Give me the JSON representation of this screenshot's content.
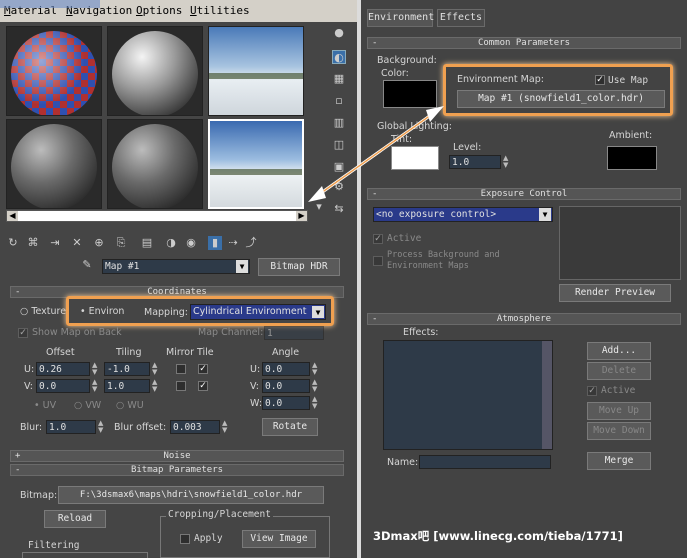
{
  "menu": {
    "items": [
      "Material",
      "Navigation",
      "Options",
      "Utilities"
    ]
  },
  "tabs": [
    "Environment",
    "Effects"
  ],
  "map_name": "Map #1",
  "map_type_button": "Bitmap HDR",
  "coordinates": {
    "title": "Coordinates",
    "texture_label": "Texture",
    "environ_label": "Environ",
    "mapping_label": "Mapping:",
    "mapping_value": "Cylindrical Environment",
    "show_map": "Show Map on Back",
    "map_channel_label": "Map Channel:",
    "map_channel_value": "1",
    "offset_label": "Offset",
    "tiling_label": "Tiling",
    "mirror_tile_label": "Mirror Tile",
    "angle_label": "Angle",
    "axes": [
      "U:",
      "V:",
      "W:"
    ],
    "offset_u": "0.26",
    "offset_v": "0.0",
    "tiling_u": "-1.0",
    "tiling_v": "1.0",
    "angle_u": "0.0",
    "angle_v": "0.0",
    "angle_w": "0.0",
    "uvw": [
      "UV",
      "VW",
      "WU"
    ],
    "blur_label": "Blur:",
    "blur_value": "1.0",
    "blur_offset_label": "Blur offset:",
    "blur_offset_value": "0.003",
    "rotate_button": "Rotate"
  },
  "noise": {
    "title": "Noise"
  },
  "bitmap_params": {
    "title": "Bitmap Parameters",
    "bitmap_label": "Bitmap:",
    "bitmap_path": "F:\\3dsmax6\\maps\\hdri\\snowfield1_color.hdr",
    "reload_button": "Reload",
    "cropping_label": "Cropping/Placement",
    "apply_label": "Apply",
    "view_image_button": "View Image",
    "filtering_label": "Filtering"
  },
  "common": {
    "title": "Common Parameters",
    "background_label": "Background:",
    "color_label": "Color:",
    "env_map_label": "Environment Map:",
    "use_map_label": "Use Map",
    "env_map_button": "Map #1 (snowfield1_color.hdr)",
    "global_lighting_label": "Global Lighting:",
    "tint_label": "Tint:",
    "level_label": "Level:",
    "level_value": "1.0",
    "ambient_label": "Ambient:"
  },
  "exposure": {
    "title": "Exposure Control",
    "dropdown_value": "<no exposure control>",
    "active_label": "Active",
    "process_label": "Process Background and Environment Maps",
    "render_preview_button": "Render Preview"
  },
  "atmosphere": {
    "title": "Atmosphere",
    "effects_label": "Effects:",
    "add_button": "Add...",
    "delete_button": "Delete",
    "active_label": "Active",
    "move_up_button": "Move Up",
    "move_down_button": "Move Down",
    "name_label": "Name:",
    "merge_button": "Merge"
  },
  "watermark": "3Dmax吧 [www.linecg.com/tieba/1771]",
  "colors": {
    "highlight": "#f0a050",
    "panel": "#454545",
    "field": "#2e3a48"
  }
}
